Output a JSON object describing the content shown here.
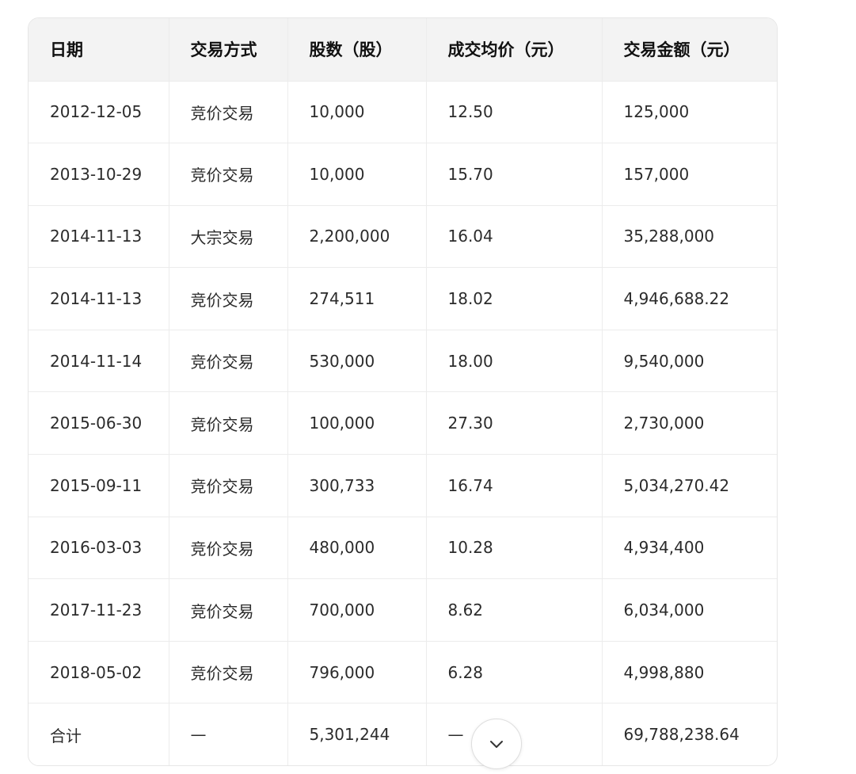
{
  "table": {
    "headers": [
      "日期",
      "交易方式",
      "股数（股）",
      "成交均价（元）",
      "交易金额（元）"
    ],
    "rows": [
      [
        "2012-12-05",
        "竞价交易",
        "10,000",
        "12.50",
        "125,000"
      ],
      [
        "2013-10-29",
        "竞价交易",
        "10,000",
        "15.70",
        "157,000"
      ],
      [
        "2014-11-13",
        "大宗交易",
        "2,200,000",
        "16.04",
        "35,288,000"
      ],
      [
        "2014-11-13",
        "竞价交易",
        "274,511",
        "18.02",
        "4,946,688.22"
      ],
      [
        "2014-11-14",
        "竞价交易",
        "530,000",
        "18.00",
        "9,540,000"
      ],
      [
        "2015-06-30",
        "竞价交易",
        "100,000",
        "27.30",
        "2,730,000"
      ],
      [
        "2015-09-11",
        "竞价交易",
        "300,733",
        "16.74",
        "5,034,270.42"
      ],
      [
        "2016-03-03",
        "竞价交易",
        "480,000",
        "10.28",
        "4,934,400"
      ],
      [
        "2017-11-23",
        "竞价交易",
        "700,000",
        "8.62",
        "6,034,000"
      ],
      [
        "2018-05-02",
        "竞价交易",
        "796,000",
        "6.28",
        "4,998,880"
      ],
      [
        "合计",
        "—",
        "5,301,244",
        "—",
        "69,788,238.64"
      ]
    ]
  },
  "scroll_button": {
    "icon": "chevron-down-icon"
  }
}
